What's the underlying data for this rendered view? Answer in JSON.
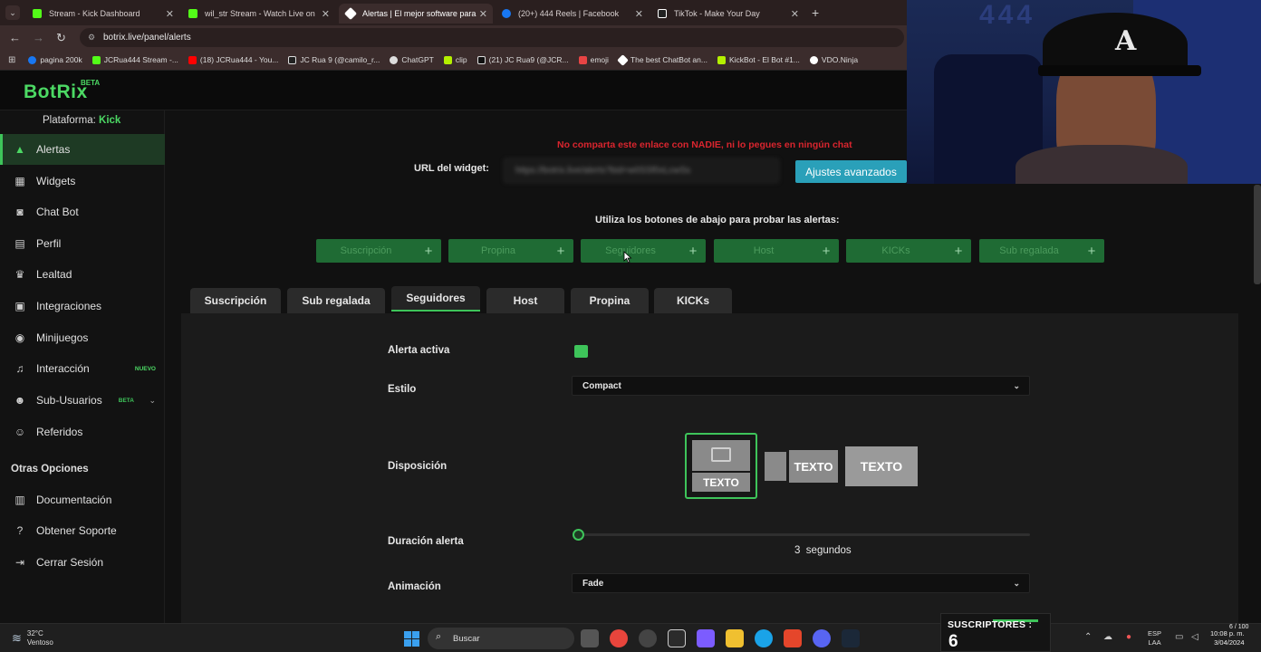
{
  "browser": {
    "tabs": [
      {
        "title": "Stream - Kick Dashboard",
        "color": "#53fc18"
      },
      {
        "title": "wil_str Stream - Watch Live on",
        "color": "#53fc18"
      },
      {
        "title": "Alertas | El mejor software para",
        "color": "#ffffff"
      },
      {
        "title": "(20+) 444 Reels | Facebook",
        "color": "#1877f2"
      },
      {
        "title": "TikTok - Make Your Day",
        "color": "#ffffff"
      }
    ],
    "url": "botrix.live/panel/alerts",
    "bookmarks": [
      {
        "label": "pagina 200k",
        "color": "#1877f2"
      },
      {
        "label": "JCRua444 Stream -...",
        "color": "#53fc18"
      },
      {
        "label": "(18) JCRua444 - You...",
        "color": "#ff0000"
      },
      {
        "label": "JC Rua 9 (@camilo_r...",
        "color": "#ffffff"
      },
      {
        "label": "ChatGPT",
        "color": "#dddddd"
      },
      {
        "label": "clip",
        "color": "#b4f000"
      },
      {
        "label": "(21) JC Rua9 (@JCR...",
        "color": "#ffffff"
      },
      {
        "label": "emoji",
        "color": "#e84444"
      },
      {
        "label": "The best ChatBot an...",
        "color": "#ffffff"
      },
      {
        "label": "KickBot - El Bot #1...",
        "color": "#b4f000"
      },
      {
        "label": "VDO.Ninja",
        "color": "#ffffff"
      }
    ]
  },
  "app": {
    "logo": "BotRix",
    "logo_badge": "BETA",
    "platform_label": "Plataforma:",
    "platform_value": "Kick"
  },
  "sidebar": {
    "items": [
      {
        "label": "Alertas",
        "icon": "warning-icon"
      },
      {
        "label": "Widgets",
        "icon": "grid-icon"
      },
      {
        "label": "Chat Bot",
        "icon": "robot-icon"
      },
      {
        "label": "Perfil",
        "icon": "profile-card-icon"
      },
      {
        "label": "Lealtad",
        "icon": "trophy-icon"
      },
      {
        "label": "Integraciones",
        "icon": "plug-icon"
      },
      {
        "label": "Minijuegos",
        "icon": "gamepad-icon"
      },
      {
        "label": "Interacción",
        "icon": "music-note-icon",
        "badge": "NUEVO"
      },
      {
        "label": "Sub-Usuarios",
        "icon": "users-icon",
        "badge": "BETA"
      },
      {
        "label": "Referidos",
        "icon": "people-icon"
      }
    ],
    "other_heading": "Otras Opciones",
    "other_items": [
      {
        "label": "Documentación",
        "icon": "document-icon"
      },
      {
        "label": "Obtener Soporte",
        "icon": "help-icon"
      },
      {
        "label": "Cerrar Sesión",
        "icon": "logout-icon"
      }
    ]
  },
  "main": {
    "warning": "No comparta este enlace con NADIE, ni lo pegues en ningún chat",
    "widget_url_label": "URL del widget:",
    "widget_url_value": "https://botrix.live/alerts?bid=w0SSf0xLcwSs",
    "advanced_button": "Ajustes avanzados",
    "test_hint": "Utiliza los botones de abajo para probar las alertas:",
    "test_buttons": [
      "Suscripción",
      "Propina",
      "Seguidores",
      "Host",
      "KICKs",
      "Sub regalada"
    ],
    "tabs": [
      "Suscripción",
      "Sub regalada",
      "Seguidores",
      "Host",
      "Propina",
      "KICKs"
    ],
    "active_tab": "Seguidores",
    "form": {
      "active_label": "Alerta activa",
      "style_label": "Estilo",
      "style_value": "Compact",
      "layout_label": "Disposición",
      "layout_text": "TEXTO",
      "duration_label": "Duración alerta",
      "duration_value": "3",
      "duration_unit": "segundos",
      "animation_label": "Animación",
      "animation_value": "Fade"
    }
  },
  "overlay": {
    "subs_label": "SUSCRIPTORES :",
    "subs_count": "6",
    "goal": "6 / 100"
  },
  "taskbar": {
    "temperature": "32°C",
    "weather": "Ventoso",
    "search_placeholder": "Buscar",
    "lang_top": "ESP",
    "lang_bottom": "LAA",
    "time": "10:08 p. m.",
    "date": "3/04/2024"
  },
  "colors": {
    "accent": "#3ec45a",
    "warning": "#d9252e",
    "advanced_button": "#2aa0b9"
  }
}
